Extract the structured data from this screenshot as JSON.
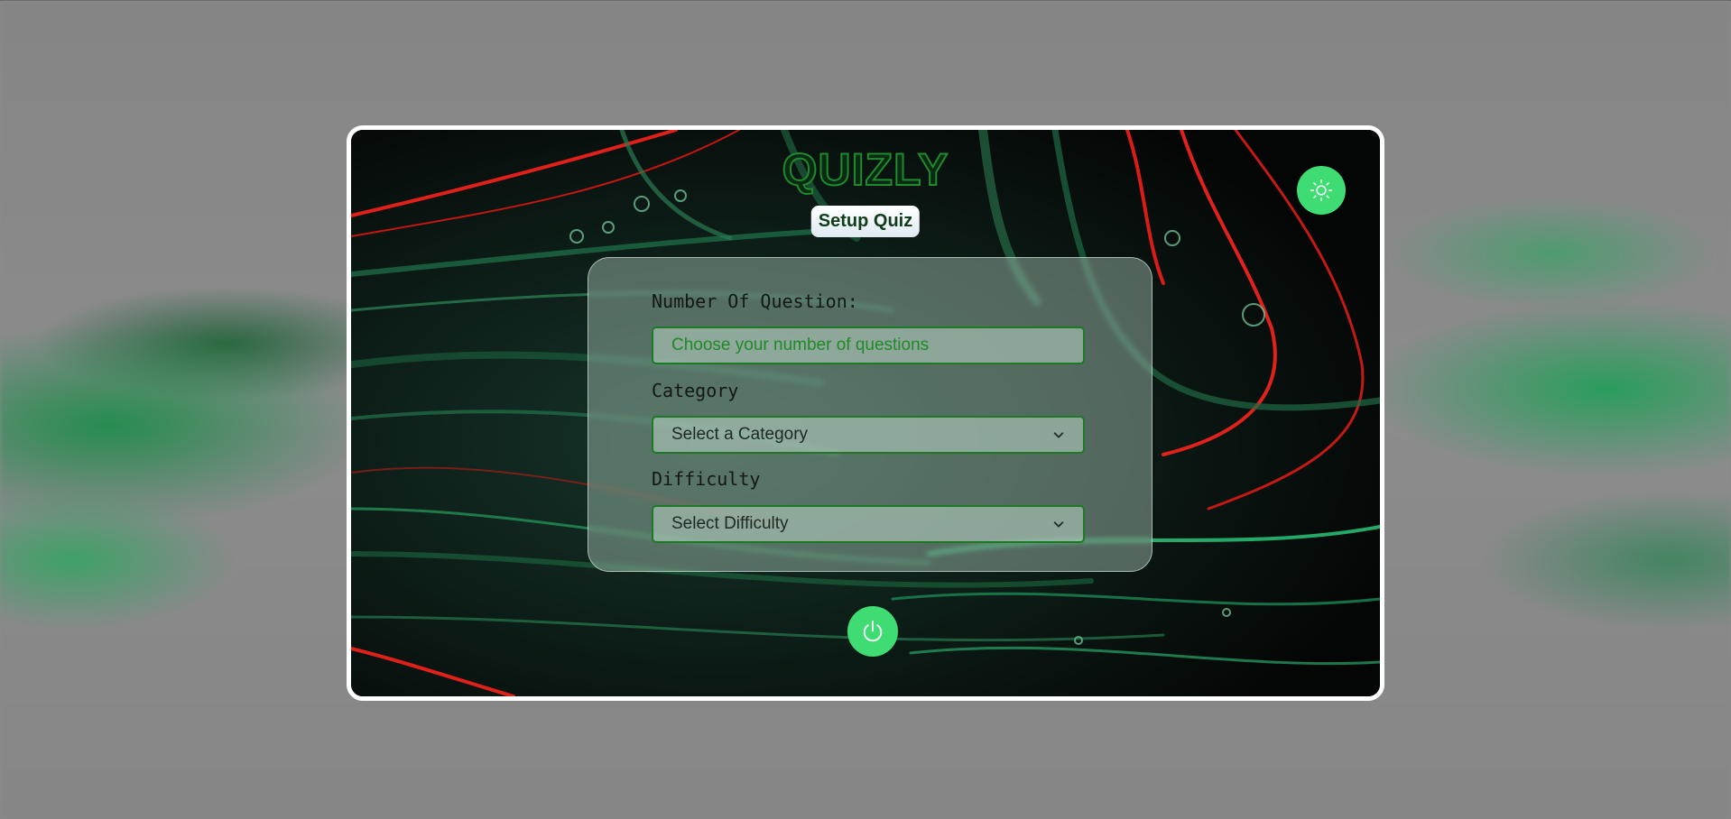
{
  "app": {
    "brand": "QUIZLY",
    "section_title": "Setup Quiz"
  },
  "icons": {
    "theme_toggle": "sun-icon",
    "start": "power-icon",
    "dropdown": "chevron-down-icon"
  },
  "form": {
    "questions": {
      "label": "Number Of Question:",
      "placeholder": "Choose your number of questions",
      "value": ""
    },
    "category": {
      "label": "Category",
      "selected": "Select a Category"
    },
    "difficulty": {
      "label": "Difficulty",
      "selected": "Select Difficulty"
    }
  },
  "colors": {
    "accent": "#3fdc73",
    "brand_outline": "#1f8a2e",
    "field_border": "#1c7a22",
    "frame_border": "#ffffff"
  }
}
